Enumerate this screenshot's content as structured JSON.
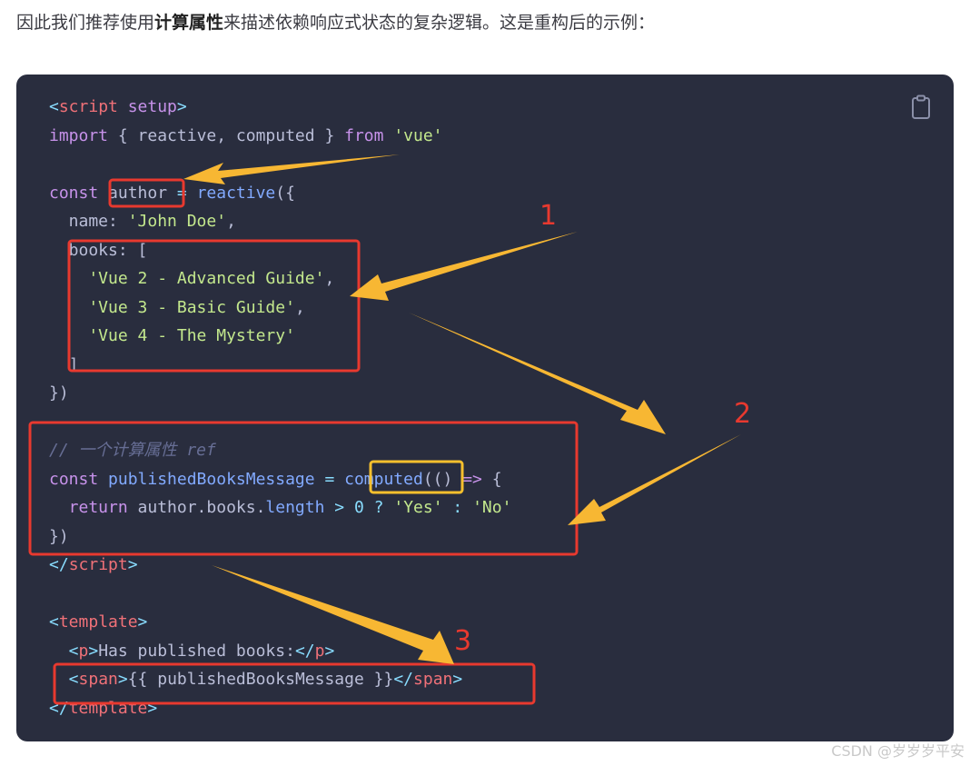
{
  "intro": {
    "text_before": "因此我们推荐使用",
    "bold": "计算属性",
    "text_after": "来描述依赖响应式状态的复杂逻辑。这是重构后的示例："
  },
  "code": {
    "l1_open": "<",
    "l1_tag": "script",
    "l1_attr": " setup",
    "l1_close": ">",
    "l2_import": "import",
    "l2_mid": " { reactive, computed } ",
    "l2_from": "from",
    "l2_str": " 'vue'",
    "l4_const": "const",
    "l4_author": "author",
    "l4_eq": " = ",
    "l4_fn": "reactive",
    "l4_end": "({",
    "l5_key": "  name: ",
    "l5_str": "'John Doe'",
    "l5_comma": ",",
    "l6": "  books: [",
    "l7_str": "    'Vue 2 - Advanced Guide'",
    "l7_comma": ",",
    "l8_str": "    'Vue 3 - Basic Guide'",
    "l8_comma": ",",
    "l9_str": "    'Vue 4 - The Mystery'",
    "l10": "  ]",
    "l11": "})",
    "l13_comment": "// 一个计算属性 ref",
    "l14_const": "const",
    "l14_name": " publishedBooksMessage",
    "l14_eq": " = ",
    "l14_fn": "computed",
    "l14_paren": "(() ",
    "l14_arrow": "=>",
    "l14_brace": " {",
    "l15_return": "  return",
    "l15_obj": " author.books.",
    "l15_len": "length",
    "l15_gt": " >",
    "l15_zero": " 0",
    "l15_q": " ?",
    "l15_yes": " 'Yes'",
    "l15_colon": " :",
    "l15_no": " 'No'",
    "l16": "})",
    "l17_open": "</",
    "l17_tag": "script",
    "l17_close": ">",
    "l19_open": "<",
    "l19_tag": "template",
    "l19_close": ">",
    "l20_open": "  <",
    "l20_tag": "p",
    "l20_close": ">",
    "l20_text": "Has published books:",
    "l20_eopen": "</",
    "l20_etag": "p",
    "l20_eclose": ">",
    "l21_open": "  <",
    "l21_tag": "span",
    "l21_close": ">",
    "l21_text": "{{ publishedBooksMessage }}",
    "l21_eopen": "</",
    "l21_etag": "span",
    "l21_eclose": ">",
    "l22_open": "</",
    "l22_tag": "template",
    "l22_close": ">"
  },
  "copy_icon": "clipboard-icon",
  "annotations": {
    "labels": [
      "1",
      "2",
      "3"
    ],
    "box_color": "#e8392f",
    "highlight_color": "#f7c02d",
    "arrow_color": "#f7b733"
  },
  "watermark": "CSDN @岁岁岁平安"
}
